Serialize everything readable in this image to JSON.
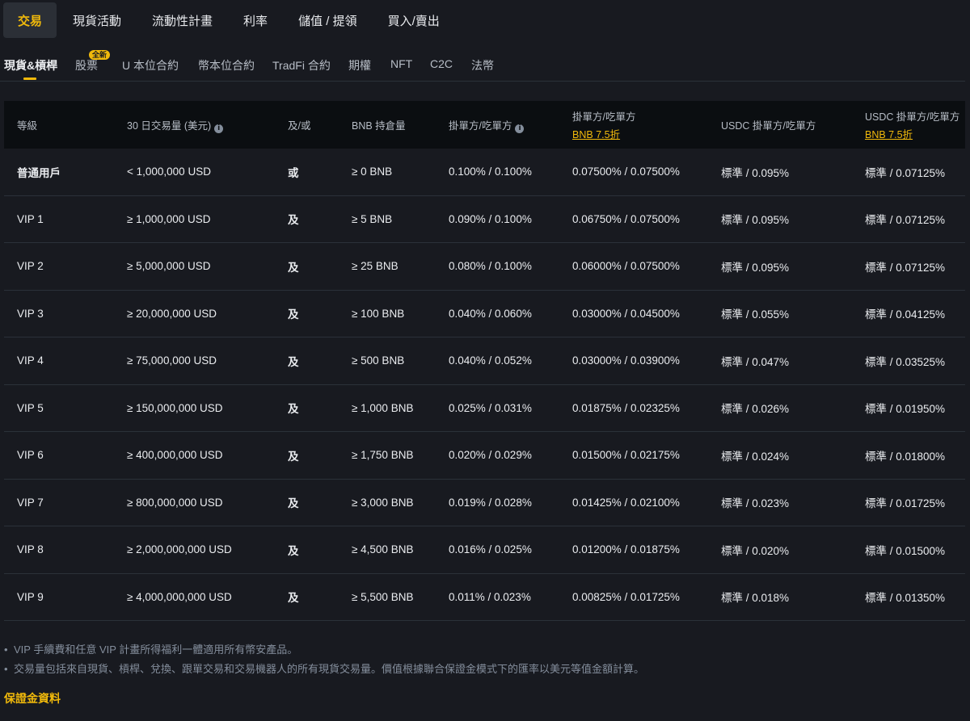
{
  "top_tabs": [
    "交易",
    "現貨活動",
    "流動性計畫",
    "利率",
    "儲值 / 提領",
    "買入/賣出"
  ],
  "sub_tabs": [
    "現貨&槓桿",
    "股票",
    "U 本位合約",
    "幣本位合約",
    "TradFi 合約",
    "期權",
    "NFT",
    "C2C",
    "法幣"
  ],
  "new_badge": "全新",
  "table": {
    "headers": {
      "level": "等級",
      "volume": "30 日交易量 (美元)",
      "andor": "及/或",
      "bnb": "BNB 持倉量",
      "maker_taker": "掛單方/吃單方",
      "maker_taker_bnb": "掛單方/吃單方",
      "maker_taker_bnb_promo": "BNB 7.5折",
      "usdc": "USDC 掛單方/吃單方",
      "usdc_bnb": "USDC 掛單方/吃單方",
      "usdc_bnb_promo": "BNB 7.5折"
    },
    "rows": [
      {
        "level": "普通用戶",
        "volume": "< 1,000,000 USD",
        "andor": "或",
        "bnb": "≥ 0 BNB",
        "mt": "0.100% / 0.100%",
        "mt_bnb": "0.07500% / 0.07500%",
        "usdc": "標準 / 0.095%",
        "usdc_bnb": "標準 / 0.07125%"
      },
      {
        "level": "VIP 1",
        "volume": "≥ 1,000,000 USD",
        "andor": "及",
        "bnb": "≥ 5 BNB",
        "mt": "0.090% / 0.100%",
        "mt_bnb": "0.06750% / 0.07500%",
        "usdc": "標準 / 0.095%",
        "usdc_bnb": "標準 / 0.07125%"
      },
      {
        "level": "VIP 2",
        "volume": "≥ 5,000,000 USD",
        "andor": "及",
        "bnb": "≥ 25 BNB",
        "mt": "0.080% / 0.100%",
        "mt_bnb": "0.06000% / 0.07500%",
        "usdc": "標準 / 0.095%",
        "usdc_bnb": "標準 / 0.07125%"
      },
      {
        "level": "VIP 3",
        "volume": "≥ 20,000,000 USD",
        "andor": "及",
        "bnb": "≥ 100 BNB",
        "mt": "0.040% / 0.060%",
        "mt_bnb": "0.03000% / 0.04500%",
        "usdc": "標準 / 0.055%",
        "usdc_bnb": "標準 / 0.04125%"
      },
      {
        "level": "VIP 4",
        "volume": "≥ 75,000,000 USD",
        "andor": "及",
        "bnb": "≥ 500 BNB",
        "mt": "0.040% / 0.052%",
        "mt_bnb": "0.03000% / 0.03900%",
        "usdc": "標準 / 0.047%",
        "usdc_bnb": "標準 / 0.03525%"
      },
      {
        "level": "VIP 5",
        "volume": "≥ 150,000,000 USD",
        "andor": "及",
        "bnb": "≥ 1,000 BNB",
        "mt": "0.025% / 0.031%",
        "mt_bnb": "0.01875% / 0.02325%",
        "usdc": "標準 / 0.026%",
        "usdc_bnb": "標準 / 0.01950%"
      },
      {
        "level": "VIP 6",
        "volume": "≥ 400,000,000 USD",
        "andor": "及",
        "bnb": "≥ 1,750 BNB",
        "mt": "0.020% / 0.029%",
        "mt_bnb": "0.01500% / 0.02175%",
        "usdc": "標準 / 0.024%",
        "usdc_bnb": "標準 / 0.01800%"
      },
      {
        "level": "VIP 7",
        "volume": "≥ 800,000,000 USD",
        "andor": "及",
        "bnb": "≥ 3,000 BNB",
        "mt": "0.019% / 0.028%",
        "mt_bnb": "0.01425% / 0.02100%",
        "usdc": "標準 / 0.023%",
        "usdc_bnb": "標準 / 0.01725%"
      },
      {
        "level": "VIP 8",
        "volume": "≥ 2,000,000,000 USD",
        "andor": "及",
        "bnb": "≥ 4,500 BNB",
        "mt": "0.016% / 0.025%",
        "mt_bnb": "0.01200% / 0.01875%",
        "usdc": "標準 / 0.020%",
        "usdc_bnb": "標準 / 0.01500%"
      },
      {
        "level": "VIP 9",
        "volume": "≥ 4,000,000,000 USD",
        "andor": "及",
        "bnb": "≥ 5,500 BNB",
        "mt": "0.011% / 0.023%",
        "mt_bnb": "0.00825% / 0.01725%",
        "usdc": "標準 / 0.018%",
        "usdc_bnb": "標準 / 0.01350%"
      }
    ]
  },
  "notes": [
    "VIP 手續費和任意 VIP 計畫所得福利一體適用所有幣安產品。",
    "交易量包括來自現貨、槓桿、兌換、跟單交易和交易機器人的所有現貨交易量。價值根據聯合保證金模式下的匯率以美元等值金額計算。"
  ],
  "margin_link": "保證金資料",
  "colors": {
    "background": "#181a20",
    "header_bg": "#0b0e11",
    "accent": "#f0b90b",
    "text": "#eaecef",
    "muted": "#848e9c"
  }
}
